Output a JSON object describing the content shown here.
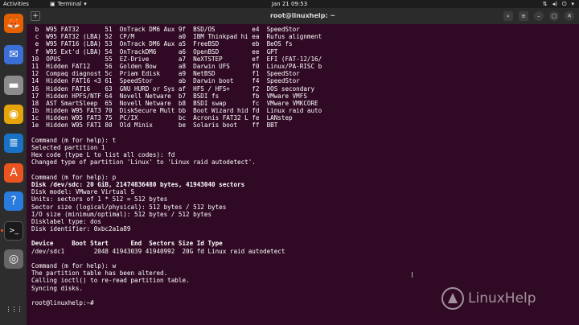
{
  "topbar": {
    "activities": "Activities",
    "app_name": "Terminal",
    "clock": "Jan 21  09:53"
  },
  "dock": {
    "items": [
      {
        "name": "firefox-icon",
        "glyph": "🦊",
        "color": "#e66000"
      },
      {
        "name": "mail-icon",
        "glyph": "✉",
        "color": "#3b6fd6"
      },
      {
        "name": "files-icon",
        "glyph": "▬",
        "color": "#8c8c8c"
      },
      {
        "name": "music-icon",
        "glyph": "◉",
        "color": "#e5a50a"
      },
      {
        "name": "writer-icon",
        "glyph": "≣",
        "color": "#1a72c6"
      },
      {
        "name": "software-icon",
        "glyph": "A",
        "color": "#e95420"
      },
      {
        "name": "help-icon",
        "glyph": "?",
        "color": "#2a7bde"
      },
      {
        "name": "terminal-icon",
        "glyph": ">_",
        "color": "#1a1a1a"
      },
      {
        "name": "dvd-icon",
        "glyph": "◎",
        "color": "#666666"
      },
      {
        "name": "apps-grid-icon",
        "glyph": "⋮⋮⋮",
        "color": "#2d2d2d"
      }
    ]
  },
  "window": {
    "title": "root@linuxhelp: ~",
    "newtab": "+"
  },
  "terminal_lines": [
    " b  W95 FAT32       51  OnTrack DM6 Aux 9f  BSD/OS          e4  SpeedStor",
    " c  W95 FAT32 (LBA) 52  CP/M            a0  IBM Thinkpad hi ea  Rufus alignment",
    " e  W95 FAT16 (LBA) 53  OnTrack DM6 Aux a5  FreeBSD         eb  BeOS fs",
    " f  W95 Ext'd (LBA) 54  OnTrackDM6      a6  OpenBSD         ee  GPT",
    "10  OPUS            55  EZ-Drive        a7  NeXTSTEP        ef  EFI (FAT-12/16/",
    "11  Hidden FAT12    56  Golden Bow      a8  Darwin UFS      f0  Linux/PA-RISC b",
    "12  Compaq diagnost 5c  Priam Edisk     a9  NetBSD          f1  SpeedStor",
    "14  Hidden FAT16 <3 61  SpeedStor       ab  Darwin boot     f4  SpeedStor",
    "16  Hidden FAT16    63  GNU HURD or Sys af  HFS / HFS+      f2  DOS secondary",
    "17  Hidden HPFS/NTF 64  Novell Netware  b7  BSDI fs         fb  VMware VMFS",
    "18  AST SmartSleep  65  Novell Netware  b8  BSDI swap       fc  VMware VMKCORE",
    "1b  Hidden W95 FAT3 70  DiskSecure Mult bb  Boot Wizard hid fd  Linux raid auto",
    "1c  Hidden W95 FAT3 75  PC/IX           bc  Acronis FAT32 L fe  LANstep",
    "1e  Hidden W95 FAT1 80  Old Minix       be  Solaris boot    ff  BBT",
    "",
    "Command (m for help): t",
    "Selected partition 1",
    "Hex code (type L to list all codes): fd",
    "Changed type of partition 'Linux' to 'Linux raid autodetect'.",
    "",
    "Command (m for help): p",
    "Disk /dev/sdc: 20 GiB, 21474836480 bytes, 41943040 sectors",
    "Disk model: VMware Virtual S",
    "Units: sectors of 1 * 512 = 512 bytes",
    "Sector size (logical/physical): 512 bytes / 512 bytes",
    "I/O size (minimum/optimal): 512 bytes / 512 bytes",
    "Disklabel type: dos",
    "Disk identifier: 0xbc2a1a89",
    "",
    "Device     Boot Start      End  Sectors Size Id Type",
    "/dev/sdc1        2048 41943039 41940992  20G fd Linux raid autodetect",
    "",
    "Command (m for help): w",
    "The partition table has been altered.",
    "Calling ioctl() to re-read partition table.",
    "Syncing disks.",
    "",
    "root@linuxhelp:~#"
  ],
  "bold_lines": [
    21,
    29
  ],
  "watermark": {
    "text": "LinuxHelp"
  },
  "colors": {
    "terminal_bg": "#300a24",
    "desktop_bg": "#2c001e",
    "accent": "#e95420"
  }
}
